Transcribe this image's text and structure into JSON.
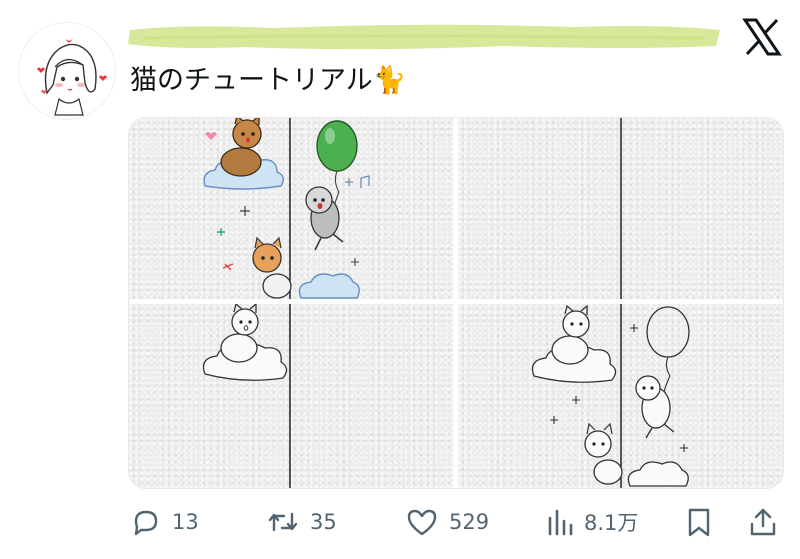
{
  "tweet": {
    "text": "猫のチュートリアル🐈",
    "author_name_redacted": true
  },
  "media": {
    "panel_count": 4
  },
  "actions": {
    "reply_count": "13",
    "retweet_count": "35",
    "like_count": "529",
    "views_count": "8.1万"
  },
  "colors": {
    "text": "#0f1419",
    "secondary": "#536471",
    "redaction": "#d8e89a"
  },
  "icons": [
    "x-logo-icon",
    "reply-icon",
    "retweet-icon",
    "like-icon",
    "views-icon",
    "bookmark-icon",
    "share-icon"
  ]
}
